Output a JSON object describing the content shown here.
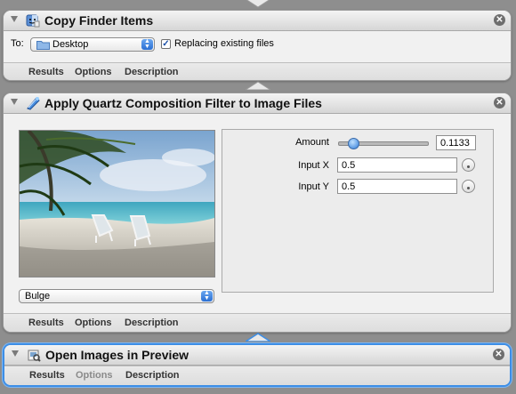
{
  "actions": [
    {
      "title": "Copy Finder Items",
      "icon": "finder-icon",
      "to_label": "To:",
      "destination": "Desktop",
      "replace_label": "Replacing existing files",
      "replace_checked": true,
      "close": "✕",
      "tabs": [
        "Results",
        "Options",
        "Description"
      ]
    },
    {
      "title": "Apply Quartz Composition Filter to Image Files",
      "icon": "quartz-composer-icon",
      "filter": "Bulge",
      "close": "✕",
      "params": {
        "amount_label": "Amount",
        "amount_value": "0.1133",
        "amount_fraction": 0.16,
        "input_x_label": "Input X",
        "input_x_value": "0.5",
        "input_y_label": "Input Y",
        "input_y_value": "0.5"
      },
      "tabs": [
        "Results",
        "Options",
        "Description"
      ]
    },
    {
      "title": "Open Images in Preview",
      "icon": "preview-icon",
      "close": "✕",
      "tabs": [
        "Results",
        "Options",
        "Description"
      ],
      "options_disabled": true
    }
  ],
  "colors": {
    "selection_border": "#3d8ee6",
    "accent_blue": "#2a6fd3"
  }
}
